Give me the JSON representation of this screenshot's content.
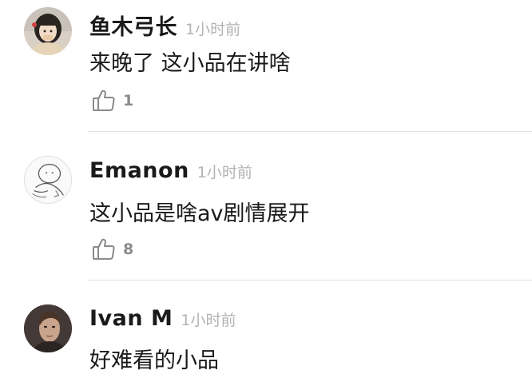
{
  "comments": [
    {
      "username": "鱼木弓长",
      "time": "1小时前",
      "content": "来晚了 这小品在讲啥",
      "likes": "1",
      "avatar_icon": "girl-avatar"
    },
    {
      "username": "Emanon",
      "time": "1小时前",
      "content": "这小品是啥av剧情展开",
      "likes": "8",
      "avatar_icon": "sketch-face-avatar"
    },
    {
      "username": "Ivan M",
      "time": "1小时前",
      "content": "好难看的小品",
      "avatar_icon": "man-photo-avatar"
    }
  ],
  "colors": {
    "text": "#1a1a1a",
    "timestamp": "#b3b3b3",
    "like": "#8a8a8a",
    "divider": "#e2e2e2"
  }
}
